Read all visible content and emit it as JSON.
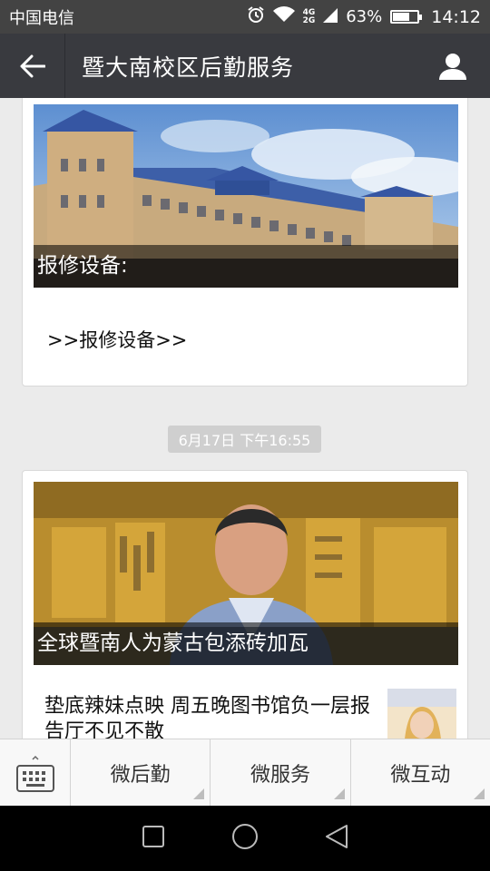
{
  "status_bar": {
    "carrier": "中国电信",
    "network_top": "4G",
    "network_bottom": "2G",
    "battery": "63%",
    "battery_level": 0.63,
    "time": "14:12"
  },
  "header": {
    "title": "暨大南校区后勤服务"
  },
  "messages": [
    {
      "cover_caption": "报修设备:",
      "link_text": ">>报修设备>>"
    },
    {
      "timestamp": "6月17日 下午16:55",
      "cover_caption": "全球暨南人为蒙古包添砖加瓦",
      "sub_item_title": "垫底辣妹点映 周五晚图书馆负一层报告厅不见不散"
    }
  ],
  "bottom_menu": {
    "items": [
      "微后勤",
      "微服务",
      "微互动"
    ]
  },
  "colors": {
    "header_bg": "#393a3f",
    "status_bg": "#434343",
    "page_bg": "#ebebeb"
  }
}
